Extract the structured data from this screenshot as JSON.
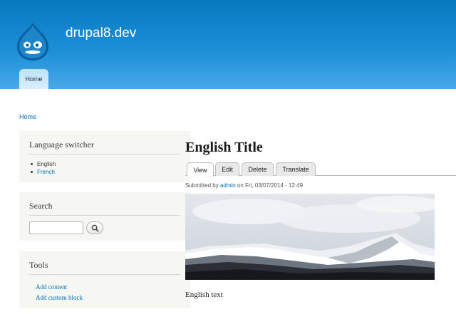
{
  "header": {
    "site_name": "drupal8.dev",
    "logo_icon": "drupal-drop-icon",
    "nav": {
      "home_label": "Home"
    },
    "colors": {
      "top": "#0779bf",
      "bottom": "#48a9e9"
    }
  },
  "breadcrumb": {
    "home_label": "Home"
  },
  "sidebar": {
    "language_switcher": {
      "title": "Language switcher",
      "items": [
        {
          "label": "English",
          "active": true
        },
        {
          "label": "French",
          "active": false
        }
      ]
    },
    "search": {
      "title": "Search",
      "input_value": "",
      "button_icon": "search-icon"
    },
    "tools": {
      "title": "Tools",
      "items": [
        "Add content",
        "Add custom block"
      ]
    }
  },
  "content": {
    "title": "English Title",
    "tabs": [
      {
        "label": "View",
        "active": true
      },
      {
        "label": "Edit",
        "active": false
      },
      {
        "label": "Delete",
        "active": false
      },
      {
        "label": "Translate",
        "active": false
      }
    ],
    "submitted": {
      "prefix": "Submitted by",
      "author": "admin",
      "suffix": "on Fri, 03/07/2014 - 12:49"
    },
    "body": "English text"
  },
  "colors": {
    "link": "#0071b3",
    "sidebar_bg": "#f6f6f2"
  }
}
